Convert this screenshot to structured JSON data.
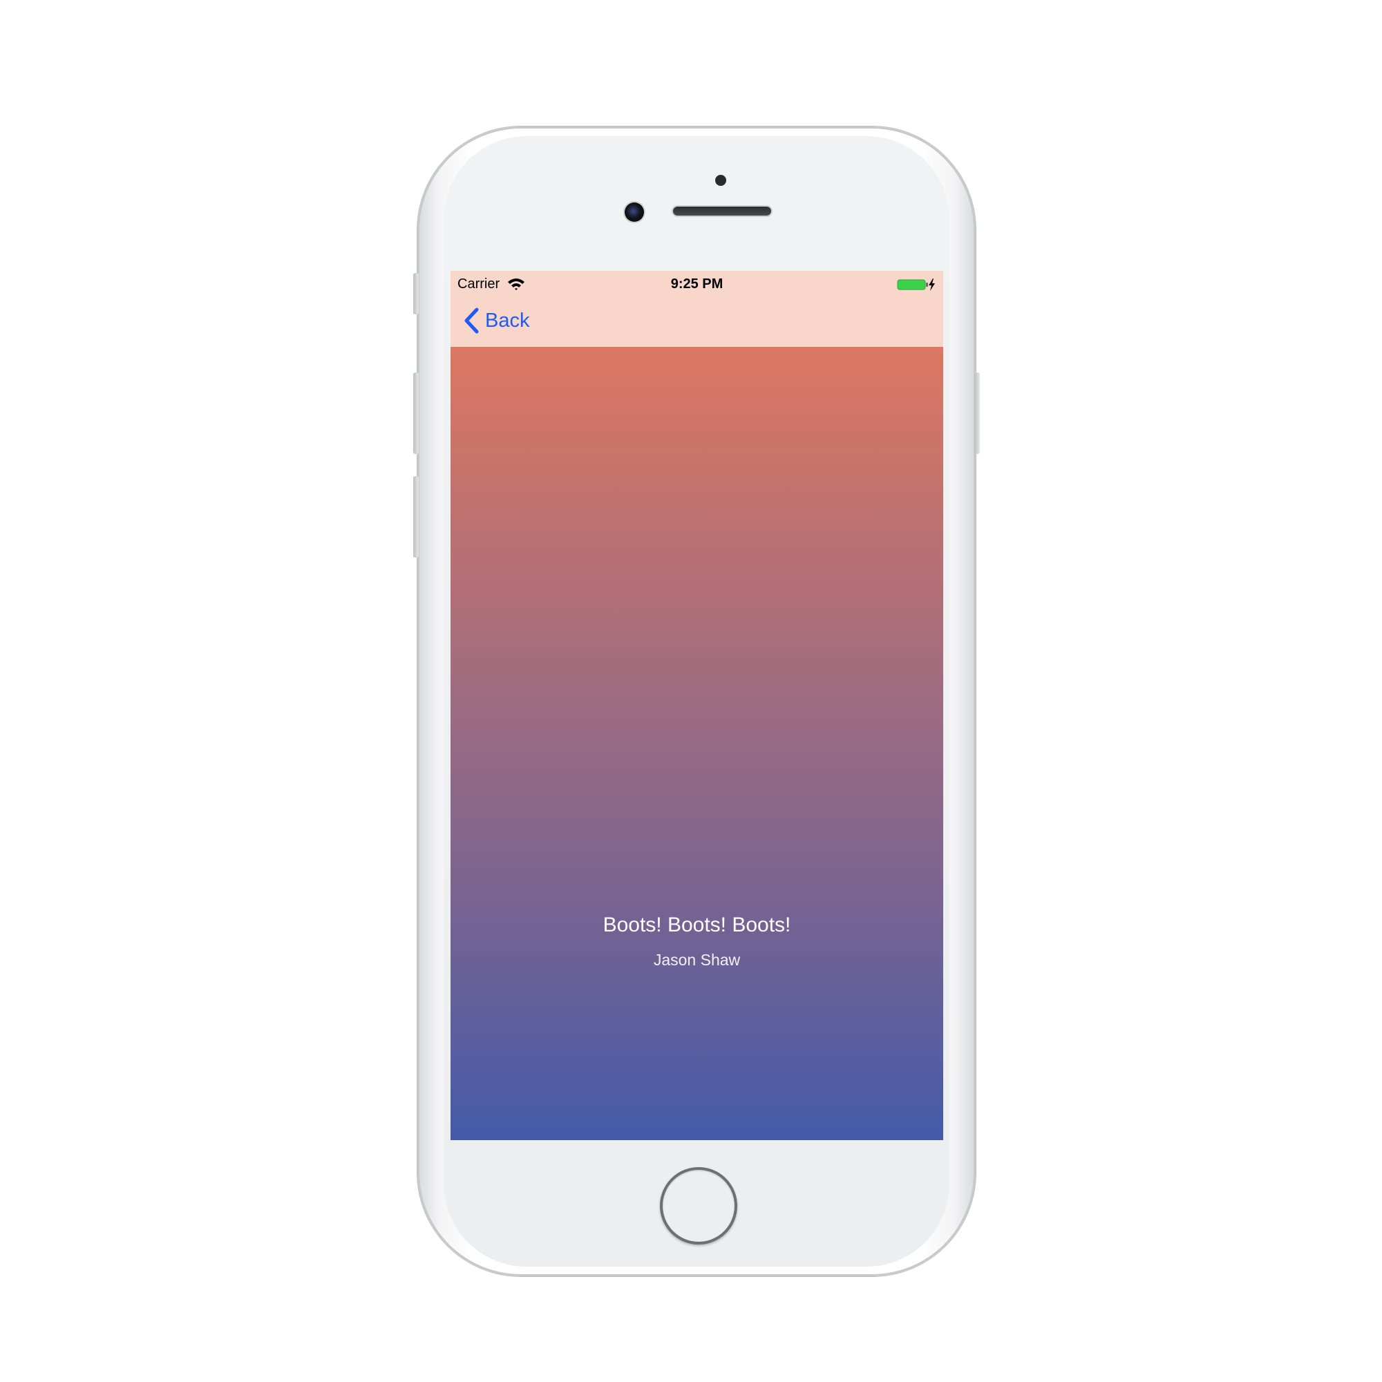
{
  "status_bar": {
    "carrier": "Carrier",
    "time": "9:25 PM",
    "battery_state": "charging",
    "battery_color": "#3cd14a"
  },
  "nav_bar": {
    "back_label": "Back",
    "accent_color": "#1f5bf0",
    "background_color": "#f8d6ca"
  },
  "now_playing": {
    "title": "Boots! Boots! Boots!",
    "artist": "Jason Shaw"
  },
  "icons": {
    "wifi": "wifi-icon",
    "battery": "battery-icon",
    "back": "chevron-left-icon",
    "home": "home-button"
  },
  "content": {
    "gradient_top": "#dc7761",
    "gradient_bottom": "#445aa8"
  }
}
